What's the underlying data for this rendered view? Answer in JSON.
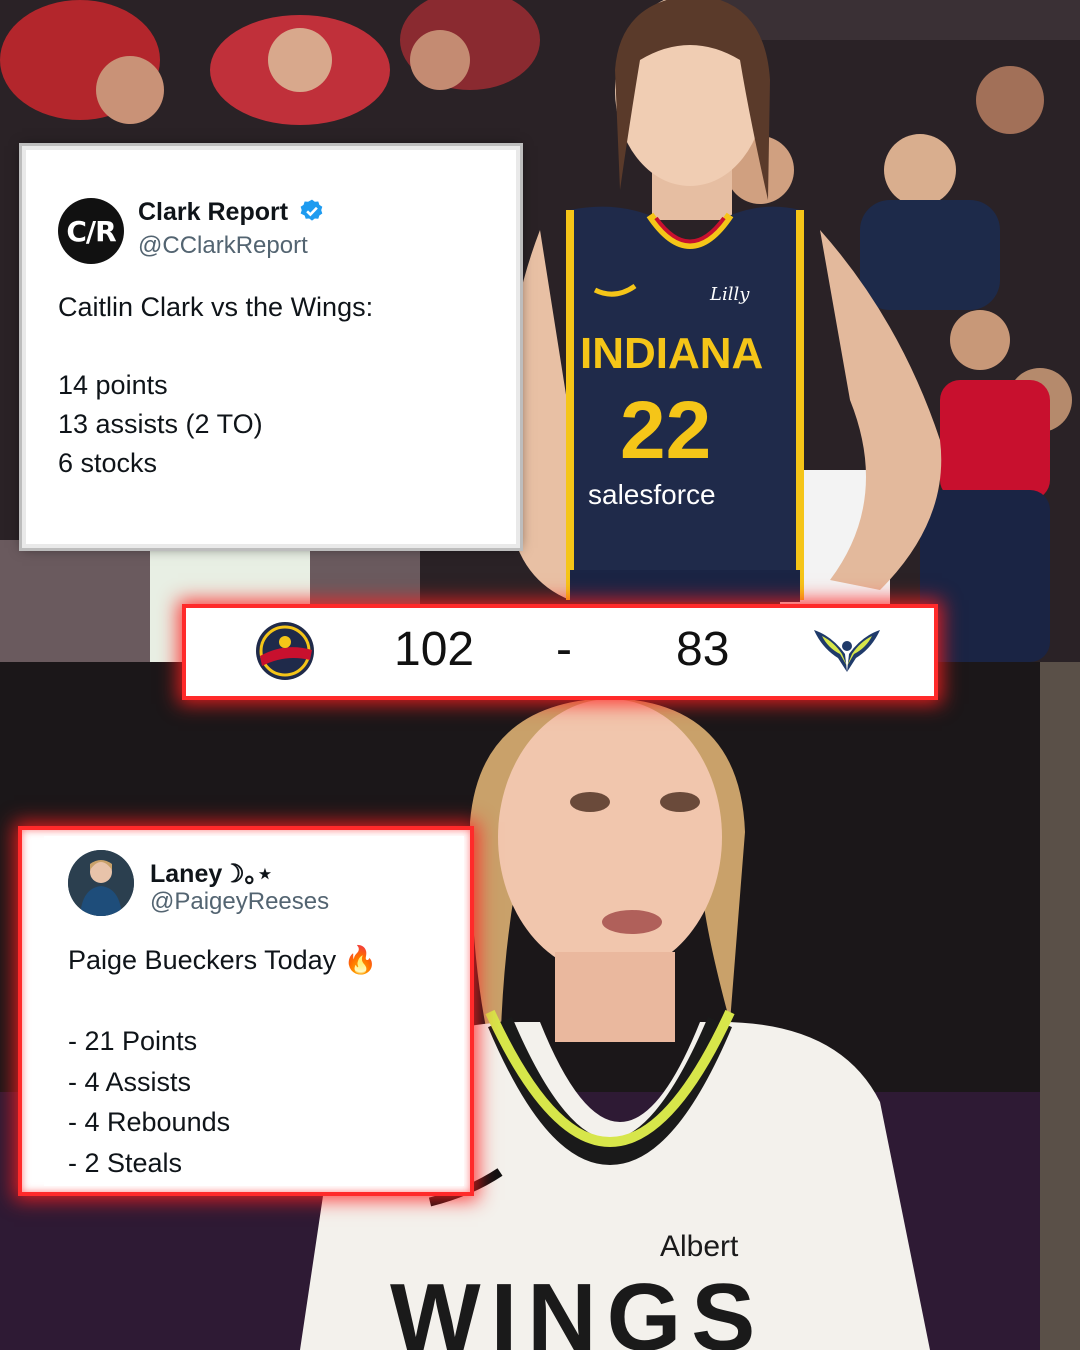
{
  "tweet_top": {
    "name": "Clark Report",
    "handle": "@CClarkReport",
    "avatar_text": "C/R",
    "verified_icon": "verified-badge-icon",
    "body": "Caitlin Clark vs the Wings:\n\n14 points\n13 assists (2 TO)\n6 stocks"
  },
  "scoreboard": {
    "home_score": "102",
    "separator": "-",
    "away_score": "83",
    "home_logo": "indiana-fever-logo",
    "away_logo": "dallas-wings-logo"
  },
  "tweet_bottom": {
    "name": "Laney☽｡⋆",
    "handle": "@PaigeyReeses",
    "body": "Paige Bueckers Today 🔥\n\n- 21 Points\n- 4 Assists\n- 4 Rebounds\n- 2 Steals"
  },
  "jersey_top": {
    "team": "INDIANA",
    "number": "22",
    "sponsor": "salesforce",
    "patch": "Lilly"
  },
  "jersey_bottom": {
    "sponsor": "Albert",
    "team": "WINGS"
  },
  "colors": {
    "accent_red": "#ff2a2a",
    "fever_navy": "#1f2a4a",
    "fever_gold": "#f5c518",
    "fever_red": "#c8102e",
    "verified_blue": "#1d9bf0"
  }
}
